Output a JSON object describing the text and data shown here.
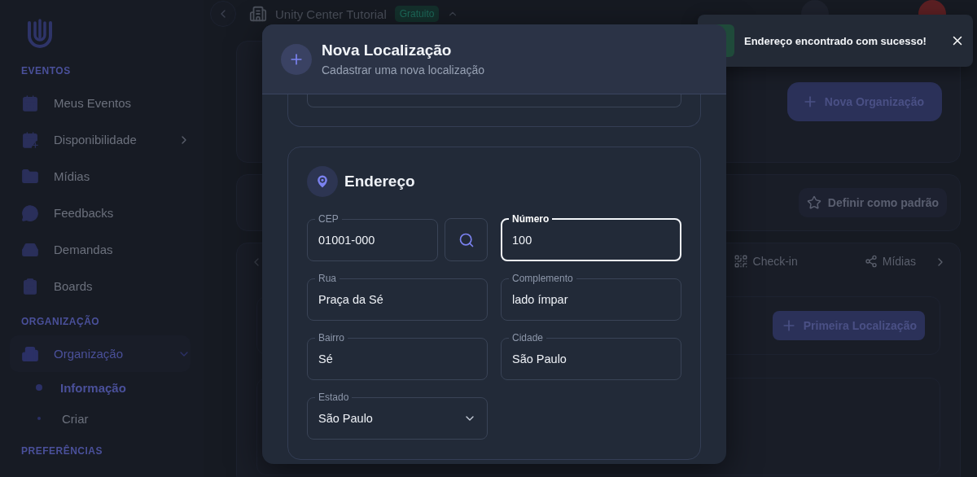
{
  "sidebar": {
    "sections": [
      {
        "title": "EVENTOS",
        "items": [
          {
            "label": "Meus Eventos",
            "selected": false
          },
          {
            "label": "Disponibilidade",
            "selected": false,
            "expanded": false
          },
          {
            "label": "Mídias",
            "selected": false
          },
          {
            "label": "Feedbacks",
            "selected": false
          },
          {
            "label": "Demandas",
            "selected": false
          },
          {
            "label": "Boards",
            "selected": false
          }
        ]
      },
      {
        "title": "ORGANIZAÇÃO",
        "items": [
          {
            "label": "Organização",
            "selected": true,
            "expanded": true,
            "children": [
              {
                "label": "Informação",
                "selected": true
              },
              {
                "label": "Criar",
                "selected": false
              }
            ]
          }
        ]
      },
      {
        "title": "PREFERÊNCIAS"
      }
    ]
  },
  "header": {
    "organization": "Unity Center Tutorial",
    "plan_badge": "Gratuito"
  },
  "page": {
    "new_org_button": "Nova Organização",
    "default_button": "Definir como padrão",
    "tabs": [
      {
        "label": "Check-in",
        "selected": false
      },
      {
        "label": "Mídias",
        "selected": false
      }
    ],
    "first_location_button": "Primeira Localização"
  },
  "modal": {
    "title": "Nova Localização",
    "subtitle": "Cadastrar uma nova localização",
    "address": {
      "title": "Endereço",
      "rows": [
        [
          {
            "kind": "text",
            "label": "CEP",
            "value": "01001-000",
            "focused": false,
            "search": true
          },
          {
            "kind": "text",
            "label": "Número",
            "value": "100",
            "focused": true
          }
        ],
        [
          {
            "kind": "text",
            "label": "Rua",
            "value": "Praça da Sé",
            "focused": false
          },
          {
            "kind": "text",
            "label": "Complemento",
            "value": "lado ímpar",
            "focused": false
          }
        ],
        [
          {
            "kind": "text",
            "label": "Bairro",
            "value": "Sé",
            "focused": false
          },
          {
            "kind": "text",
            "label": "Cidade",
            "value": "São Paulo",
            "focused": false
          }
        ],
        [
          {
            "kind": "select",
            "label": "Estado",
            "value": "São Paulo",
            "focused": false
          }
        ]
      ]
    }
  },
  "toast": {
    "kind": "success",
    "message": "Endereço encontrado com sucesso!"
  }
}
